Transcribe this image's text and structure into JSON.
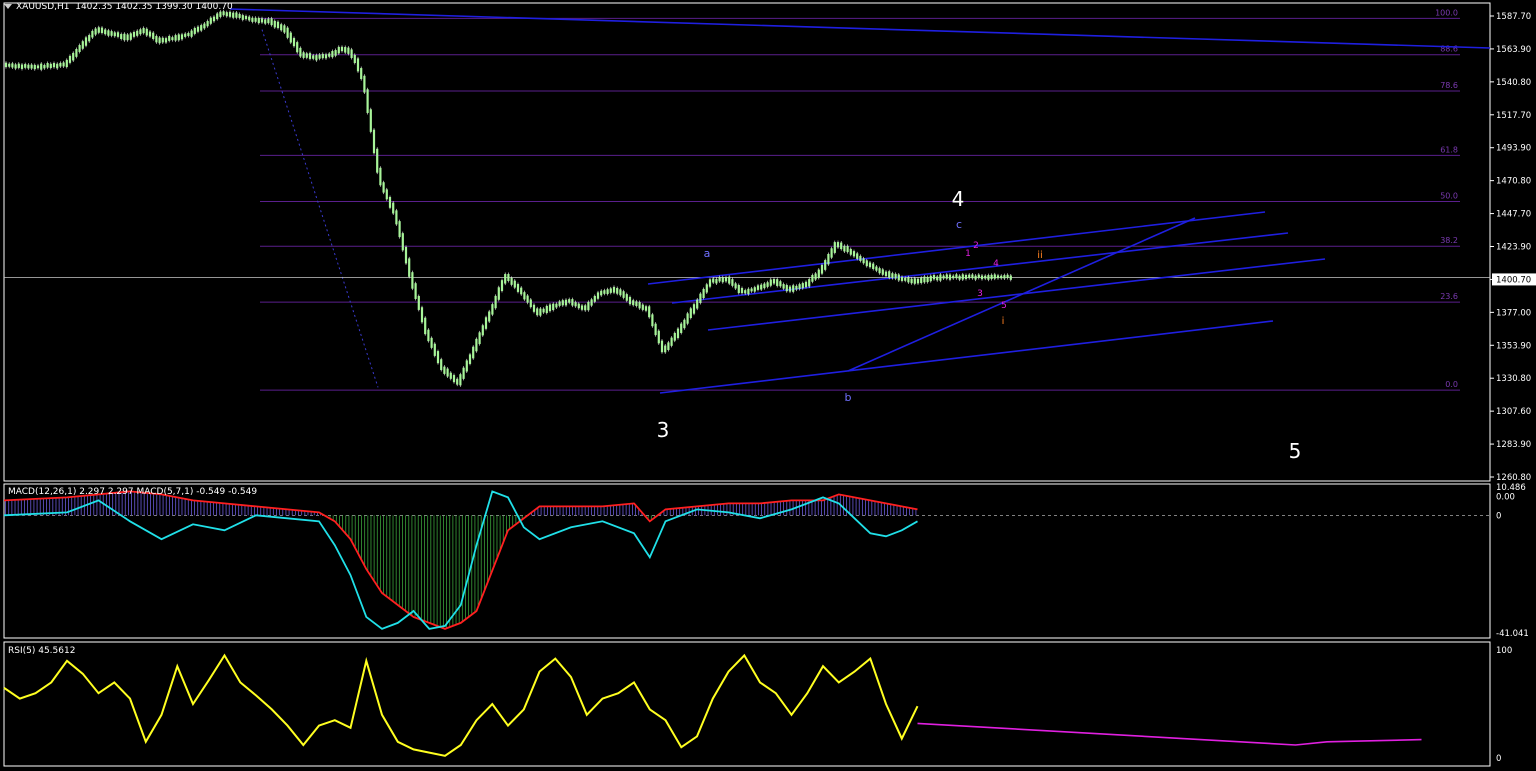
{
  "header": {
    "symbol": "XAUUSD,H1",
    "ohlc": "1402.35 1402.35 1399.30 1400.70"
  },
  "colors": {
    "background": "#000000",
    "grid_frame": "#ffffff",
    "candle_body": "#a8f59a",
    "trendline": "#1f1fe0",
    "fib_line": "#5a1f8c",
    "macd_fast": "#20e0e8",
    "macd_slow": "#ff2020",
    "rsi_line": "#ffff20",
    "rsi_projection": "#e020e0",
    "current_price_line": "#c8c8c8"
  },
  "price_axis": {
    "labels": [
      "1587.70",
      "1563.90",
      "1540.80",
      "1517.70",
      "1493.90",
      "1470.80",
      "1447.70",
      "1423.90",
      "1400.70",
      "1377.00",
      "1353.90",
      "1330.80",
      "1307.60",
      "1283.90",
      "1260.80"
    ],
    "current_price": "1400.70"
  },
  "fibonacci": {
    "levels": [
      {
        "label": "100.0",
        "price": 1586
      },
      {
        "label": "88.6",
        "price": 1560
      },
      {
        "label": "78.6",
        "price": 1534
      },
      {
        "label": "61.8",
        "price": 1488
      },
      {
        "label": "50.0",
        "price": 1455
      },
      {
        "label": "38.2",
        "price": 1423
      },
      {
        "label": "23.6",
        "price": 1383
      },
      {
        "label": "0.0",
        "price": 1320
      }
    ]
  },
  "wave_labels": {
    "w3": "3",
    "w4": "4",
    "w5": "5",
    "a": "a",
    "b": "b",
    "c": "c",
    "s1": "1",
    "s2": "2",
    "s3": "3",
    "s4": "4",
    "s5": "5",
    "i": "i",
    "ii": "ii"
  },
  "macd": {
    "title": "MACD(12,26,1) 2.297 2.297  MACD(5,7,1) -0.549 -0.549",
    "axis_labels": {
      "top": "10.486",
      "zero_upper": "0.00",
      "zero": "0",
      "bottom": "-41.041"
    }
  },
  "rsi": {
    "title": "RSI(5) 45.5612",
    "axis_labels": {
      "top": "100",
      "bottom": "0"
    }
  },
  "chart_data": [
    {
      "type": "line",
      "title": "XAUUSD,H1",
      "xlabel": "",
      "ylabel": "",
      "ylim": [
        1255,
        1597
      ],
      "series": [
        {
          "x": [
            0,
            2,
            4,
            6,
            8,
            9,
            10,
            11,
            12,
            13,
            14,
            15,
            16,
            17,
            18,
            19,
            20,
            21,
            21.5,
            22,
            22.5,
            23,
            23.5,
            24,
            25,
            26,
            27,
            28,
            29,
            30,
            31,
            32,
            33,
            34,
            35,
            36,
            37,
            38,
            39,
            40,
            41,
            42,
            43,
            44,
            45,
            46,
            47,
            48,
            49,
            50,
            51,
            52,
            53,
            54,
            55,
            56,
            57,
            58,
            59,
            60,
            61,
            62,
            63,
            64
          ],
          "values": [
            1553,
            1551,
            1553,
            1578,
            1572,
            1578,
            1570,
            1572,
            1575,
            1582,
            1590,
            1588,
            1585,
            1584,
            1578,
            1560,
            1558,
            1560,
            1565,
            1563,
            1555,
            1540,
            1505,
            1470,
            1445,
            1400,
            1360,
            1335,
            1325,
            1350,
            1375,
            1402,
            1390,
            1375,
            1380,
            1384,
            1378,
            1390,
            1392,
            1383,
            1378,
            1348,
            1362,
            1380,
            1398,
            1400,
            1390,
            1393,
            1398,
            1392,
            1395,
            1405,
            1425,
            1418,
            1410,
            1404,
            1400,
            1398,
            1400,
            1401,
            1401,
            1401,
            1401,
            1401
          ]
        }
      ]
    },
    {
      "type": "line",
      "title": "MACD(12,26,1) 2.297 2.297  MACD(5,7,1) -0.549 -0.549",
      "xlabel": "",
      "ylabel": "",
      "ylim": [
        -41.041,
        10.486
      ],
      "series": [
        {
          "x": [
            0,
            4,
            8,
            10,
            12,
            14,
            16,
            18,
            20,
            21,
            22,
            23,
            24,
            25,
            26,
            27,
            28,
            29,
            30,
            32,
            34,
            36,
            38,
            40,
            41,
            42,
            44,
            46,
            48,
            50,
            52,
            53,
            54,
            55,
            56,
            57,
            58
          ],
          "values": [
            5,
            6,
            8,
            7,
            5,
            4,
            3,
            2,
            1,
            -2,
            -8,
            -18,
            -26,
            -30,
            -34,
            -36,
            -38,
            -36,
            -32,
            -5,
            3,
            3,
            3,
            4,
            -2,
            2,
            3,
            4,
            4,
            5,
            5,
            7,
            6,
            5,
            4,
            3,
            2
          ]
        },
        {
          "x": [
            0,
            4,
            6,
            8,
            10,
            12,
            14,
            16,
            18,
            20,
            21,
            22,
            23,
            24,
            25,
            26,
            27,
            28,
            29,
            30,
            31,
            32,
            33,
            34,
            36,
            38,
            40,
            41,
            42,
            44,
            46,
            48,
            50,
            52,
            53,
            54,
            55,
            56,
            57,
            58
          ],
          "values": [
            0,
            1,
            5,
            -2,
            -8,
            -3,
            -5,
            0,
            -1,
            -2,
            -10,
            -20,
            -34,
            -38,
            -36,
            -32,
            -38,
            -37,
            -30,
            -10,
            8,
            6,
            -4,
            -8,
            -4,
            -2,
            -6,
            -14,
            -2,
            2,
            1,
            -1,
            2,
            6,
            4,
            -1,
            -6,
            -7,
            -5,
            -2
          ]
        }
      ]
    },
    {
      "type": "line",
      "title": "RSI(5) 45.5612",
      "xlabel": "",
      "ylabel": "",
      "ylim": [
        0,
        100
      ],
      "series": [
        {
          "x": [
            0,
            1,
            2,
            3,
            4,
            5,
            6,
            7,
            8,
            9,
            10,
            11,
            12,
            13,
            14,
            15,
            16,
            17,
            18,
            19,
            20,
            21,
            22,
            23,
            24,
            25,
            26,
            27,
            28,
            29,
            30,
            31,
            32,
            33,
            34,
            35,
            36,
            37,
            38,
            39,
            40,
            41,
            42,
            43,
            44,
            45,
            46,
            47,
            48,
            49,
            50,
            51,
            52,
            53,
            54,
            55,
            56,
            57,
            58
          ],
          "values": [
            65,
            55,
            60,
            70,
            90,
            78,
            60,
            70,
            55,
            15,
            40,
            85,
            50,
            72,
            95,
            70,
            58,
            45,
            30,
            12,
            30,
            35,
            28,
            90,
            40,
            15,
            8,
            5,
            2,
            12,
            35,
            50,
            30,
            45,
            80,
            92,
            75,
            40,
            55,
            60,
            70,
            45,
            35,
            10,
            20,
            55,
            80,
            95,
            70,
            60,
            40,
            60,
            85,
            70,
            80,
            92,
            50,
            18,
            48
          ]
        },
        {
          "x": [
            58,
            70,
            82,
            84,
            90
          ],
          "values": [
            32,
            22,
            12,
            15,
            17
          ]
        }
      ]
    }
  ]
}
